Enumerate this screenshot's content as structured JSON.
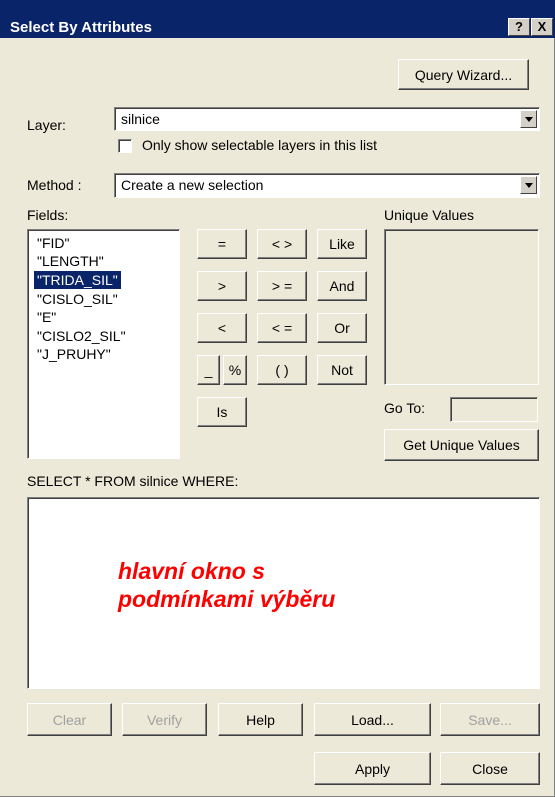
{
  "window": {
    "title": "Select By Attributes",
    "help_btn": "?",
    "close_btn": "X"
  },
  "query_wizard_label": "Query Wizard...",
  "layer": {
    "label": "Layer:",
    "value": "silnice",
    "icon": "chevron-down-icon"
  },
  "only_selectable": {
    "label": "Only show selectable layers in this list",
    "checked": false
  },
  "method": {
    "label": "Method :",
    "value": "Create a new selection"
  },
  "fields": {
    "label": "Fields:",
    "items": [
      "\"FID\"",
      "\"LENGTH\"",
      "\"TRIDA_SIL\"",
      "\"CISLO_SIL\"",
      "\"E\"",
      "\"CISLO2_SIL\"",
      "\"J_PRUHY\""
    ],
    "selected_index": 2
  },
  "operators": [
    "=",
    "< >",
    "Like",
    ">",
    "> =",
    "And",
    "<",
    "< =",
    "Or",
    "_",
    "%",
    "( )",
    "Not",
    "Is"
  ],
  "unique_values": {
    "label": "Unique Values",
    "go_to_label": "Go To:",
    "go_to_value": "",
    "get_button": "Get Unique Values"
  },
  "sql": {
    "label": "SELECT * FROM silnice WHERE:",
    "text": ""
  },
  "annotation": {
    "line1": "hlavní okno s",
    "line2": "podmínkami výběru",
    "color": "#ff0000"
  },
  "buttons": {
    "clear": "Clear",
    "verify": "Verify",
    "help": "Help",
    "load": "Load...",
    "save": "Save...",
    "apply": "Apply",
    "close": "Close"
  }
}
